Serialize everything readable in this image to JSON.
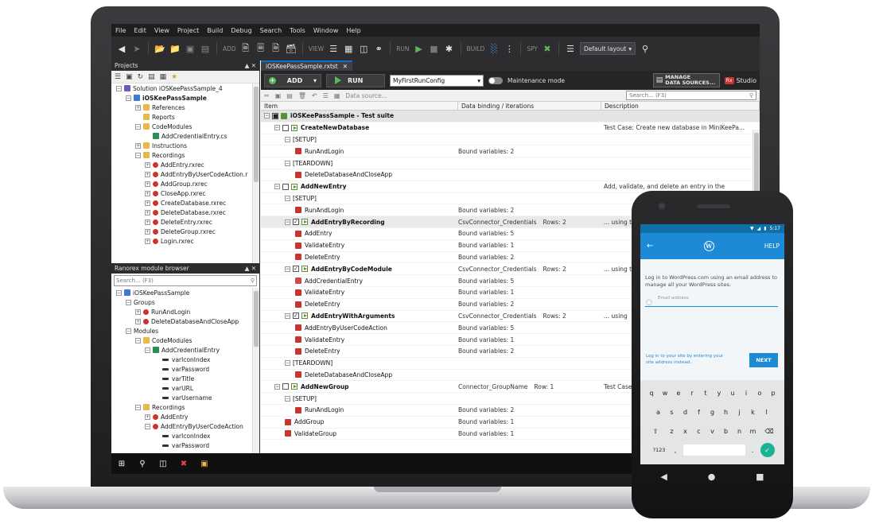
{
  "menu": [
    "File",
    "Edit",
    "View",
    "Project",
    "Build",
    "Debug",
    "Search",
    "Tools",
    "Window",
    "Help"
  ],
  "toolbar": {
    "add_label": "ADD",
    "view_label": "VIEW",
    "run_label": "RUN",
    "build_label": "BUILD",
    "spy_label": "SPY",
    "layout_value": "Default layout"
  },
  "projects_panel": {
    "title": "Projects",
    "items": [
      {
        "label": "Solution iOSKeePassSample_4",
        "level": 0,
        "icon": "solution",
        "toggle": "-"
      },
      {
        "label": "iOSKeePassSample",
        "level": 1,
        "icon": "project",
        "toggle": "-",
        "bold": true
      },
      {
        "label": "References",
        "level": 2,
        "icon": "folder",
        "toggle": "+"
      },
      {
        "label": "Reports",
        "level": 2,
        "icon": "folder",
        "toggle": ""
      },
      {
        "label": "CodeModules",
        "level": 2,
        "icon": "folder",
        "toggle": "-"
      },
      {
        "label": "AddCredentialEntry.cs",
        "level": 3,
        "icon": "cs",
        "toggle": ""
      },
      {
        "label": "Instructions",
        "level": 2,
        "icon": "folder",
        "toggle": "+"
      },
      {
        "label": "Recordings",
        "level": 2,
        "icon": "folder",
        "toggle": "-"
      },
      {
        "label": "AddEntry.rxrec",
        "level": 3,
        "icon": "rec",
        "toggle": "+"
      },
      {
        "label": "AddEntryByUserCodeAction.r",
        "level": 3,
        "icon": "rec",
        "toggle": "+"
      },
      {
        "label": "AddGroup.rxrec",
        "level": 3,
        "icon": "rec",
        "toggle": "+"
      },
      {
        "label": "CloseApp.rxrec",
        "level": 3,
        "icon": "rec",
        "toggle": "+"
      },
      {
        "label": "CreateDatabase.rxrec",
        "level": 3,
        "icon": "rec",
        "toggle": "+"
      },
      {
        "label": "DeleteDatabase.rxrec",
        "level": 3,
        "icon": "rec",
        "toggle": "+"
      },
      {
        "label": "DeleteEntry.rxrec",
        "level": 3,
        "icon": "rec",
        "toggle": "+"
      },
      {
        "label": "DeleteGroup.rxrec",
        "level": 3,
        "icon": "rec",
        "toggle": "+"
      },
      {
        "label": "Login.rxrec",
        "level": 3,
        "icon": "rec",
        "toggle": "+"
      }
    ]
  },
  "module_browser": {
    "title": "Ranorex module browser",
    "search_placeholder": "Search... (F3)",
    "items": [
      {
        "label": "iOSKeePassSample",
        "level": 0,
        "icon": "project",
        "toggle": "-"
      },
      {
        "label": "Groups",
        "level": 1,
        "icon": "none",
        "toggle": "-"
      },
      {
        "label": "RunAndLogin",
        "level": 2,
        "icon": "rec",
        "toggle": "+"
      },
      {
        "label": "DeleteDatabaseAndCloseApp",
        "level": 2,
        "icon": "rec",
        "toggle": "+"
      },
      {
        "label": "Modules",
        "level": 1,
        "icon": "none",
        "toggle": "-"
      },
      {
        "label": "CodeModules",
        "level": 2,
        "icon": "folder",
        "toggle": "-"
      },
      {
        "label": "AddCredentialEntry",
        "level": 3,
        "icon": "cs",
        "toggle": "-"
      },
      {
        "label": "varIconIndex",
        "level": 4,
        "icon": "var",
        "toggle": ""
      },
      {
        "label": "varPassword",
        "level": 4,
        "icon": "var",
        "toggle": ""
      },
      {
        "label": "varTitle",
        "level": 4,
        "icon": "var",
        "toggle": ""
      },
      {
        "label": "varURL",
        "level": 4,
        "icon": "var",
        "toggle": ""
      },
      {
        "label": "varUsername",
        "level": 4,
        "icon": "var",
        "toggle": ""
      },
      {
        "label": "Recordings",
        "level": 2,
        "icon": "folder",
        "toggle": "-"
      },
      {
        "label": "AddEntry",
        "level": 3,
        "icon": "rec",
        "toggle": "+"
      },
      {
        "label": "AddEntryByUserCodeAction",
        "level": 3,
        "icon": "rec",
        "toggle": "-"
      },
      {
        "label": "varIconIndex",
        "level": 4,
        "icon": "var",
        "toggle": ""
      },
      {
        "label": "varPassword",
        "level": 4,
        "icon": "var",
        "toggle": ""
      }
    ]
  },
  "document": {
    "tab_title": "iOSKeePassSample.rxtst",
    "add_button": "ADD",
    "run_button": "RUN",
    "run_config": "MyFirstRunConfig",
    "maintenance_label": "Maintenance mode",
    "manage_button_line1": "MANAGE",
    "manage_button_line2": "DATA SOURCES...",
    "studio_label": "Studio",
    "data_source_label": "Data source...",
    "search_placeholder": "Search... (F3)",
    "columns": [
      "Item",
      "Data binding / iterations",
      "Description"
    ],
    "rows": [
      {
        "type": "suite",
        "level": 0,
        "item": "iOSKeePassSample - Test suite",
        "binding": "",
        "desc": ""
      },
      {
        "type": "tc",
        "level": 1,
        "item": "CreateNewDatabase",
        "binding": "",
        "desc": "Test Case: Create new database in MiniKeePa..."
      },
      {
        "type": "setup",
        "level": 2,
        "item": "[SETUP]",
        "binding": "",
        "desc": ""
      },
      {
        "type": "rec",
        "level": 3,
        "item": "RunAndLogin",
        "binding": "Bound variables: 2",
        "desc": ""
      },
      {
        "type": "setup",
        "level": 2,
        "item": "[TEARDOWN]",
        "binding": "",
        "desc": ""
      },
      {
        "type": "rec",
        "level": 3,
        "item": "DeleteDatabaseAndCloseApp",
        "binding": "",
        "desc": ""
      },
      {
        "type": "tc",
        "level": 1,
        "item": "AddNewEntry",
        "binding": "",
        "desc": "Add, validate, and delete an entry in the"
      },
      {
        "type": "setup",
        "level": 2,
        "item": "[SETUP]",
        "binding": "",
        "desc": ""
      },
      {
        "type": "rec",
        "level": 3,
        "item": "RunAndLogin",
        "binding": "Bound variables: 2",
        "desc": ""
      },
      {
        "type": "tc",
        "level": 2,
        "item": "AddEntryByRecording",
        "binding": "CsvConnector_Credentials",
        "rows": "Rows: 2",
        "desc": "... using t",
        "sel": true
      },
      {
        "type": "rec",
        "level": 3,
        "item": "AddEntry",
        "binding": "Bound variables: 5",
        "desc": ""
      },
      {
        "type": "rec",
        "level": 3,
        "item": "ValidateEntry",
        "binding": "Bound variables: 1",
        "desc": ""
      },
      {
        "type": "rec",
        "level": 3,
        "item": "DeleteEntry",
        "binding": "Bound variables: 2",
        "desc": ""
      },
      {
        "type": "tc",
        "level": 2,
        "item": "AddEntryByCodeModule",
        "binding": "CsvConnector_Credentials",
        "rows": "Rows: 2",
        "desc": "... using t"
      },
      {
        "type": "code",
        "level": 3,
        "item": "AddCredentialEntry",
        "binding": "Bound variables: 5",
        "desc": ""
      },
      {
        "type": "rec",
        "level": 3,
        "item": "ValidateEntry",
        "binding": "Bound variables: 1",
        "desc": ""
      },
      {
        "type": "rec",
        "level": 3,
        "item": "DeleteEntry",
        "binding": "Bound variables: 2",
        "desc": ""
      },
      {
        "type": "tc",
        "level": 2,
        "item": "AddEntryWithArguments",
        "binding": "CsvConnector_Credentials",
        "rows": "Rows: 2",
        "desc": "... using"
      },
      {
        "type": "rec",
        "level": 3,
        "item": "AddEntryByUserCodeAction",
        "binding": "Bound variables: 5",
        "desc": ""
      },
      {
        "type": "rec",
        "level": 3,
        "item": "ValidateEntry",
        "binding": "Bound variables: 1",
        "desc": ""
      },
      {
        "type": "rec",
        "level": 3,
        "item": "DeleteEntry",
        "binding": "Bound variables: 2",
        "desc": ""
      },
      {
        "type": "setup",
        "level": 2,
        "item": "[TEARDOWN]",
        "binding": "",
        "desc": ""
      },
      {
        "type": "rec",
        "level": 3,
        "item": "DeleteDatabaseAndCloseApp",
        "binding": "",
        "desc": ""
      },
      {
        "type": "tc",
        "level": 1,
        "item": "AddNewGroup",
        "binding": "Connector_GroupName",
        "rows": "Row: 1",
        "desc": "Test Case"
      },
      {
        "type": "setup",
        "level": 2,
        "item": "[SETUP]",
        "binding": "",
        "desc": ""
      },
      {
        "type": "rec",
        "level": 3,
        "item": "RunAndLogin",
        "binding": "Bound variables: 2",
        "desc": ""
      },
      {
        "type": "rec",
        "level": 2,
        "item": "AddGroup",
        "binding": "Bound variables: 1",
        "desc": ""
      },
      {
        "type": "rec",
        "level": 2,
        "item": "ValidateGroup",
        "binding": "Bound variables: 1",
        "desc": ""
      }
    ]
  },
  "phone": {
    "time": "5:17",
    "help_label": "HELP",
    "intro_text": "Log in to WordPress.com using an email address to manage all your WordPress sites.",
    "email_label": "Email address",
    "site_link": "Log in to your site by entering your site address instead.",
    "next_button": "NEXT",
    "key_rows": [
      [
        "q",
        "w",
        "e",
        "r",
        "t",
        "y",
        "u",
        "i",
        "o",
        "p"
      ],
      [
        "a",
        "s",
        "d",
        "f",
        "g",
        "h",
        "j",
        "k",
        "l"
      ],
      [
        "z",
        "x",
        "c",
        "v",
        "b",
        "n",
        "m"
      ]
    ],
    "num_key": "?123",
    "dot_key": "."
  },
  "colors": {
    "ide_dark": "#2d2d30",
    "run_green": "#5cb85c",
    "wp_blue": "#1c8ad4",
    "ranorex_red": "#c8352f"
  }
}
